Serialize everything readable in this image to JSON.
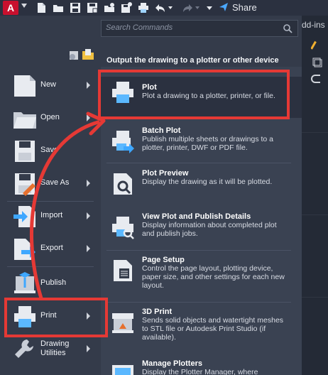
{
  "app": {
    "logo_letter": "A",
    "share_label": "Share"
  },
  "search": {
    "placeholder": "Search Commands"
  },
  "left_menu": {
    "items": [
      {
        "label": "New",
        "has_arrow": true,
        "icon": "new-icon"
      },
      {
        "label": "Open",
        "has_arrow": true,
        "icon": "open-icon"
      },
      {
        "label": "Save",
        "has_arrow": false,
        "icon": "save-icon"
      },
      {
        "label": "Save As",
        "has_arrow": true,
        "icon": "save-as-icon"
      },
      {
        "label": "Import",
        "has_arrow": true,
        "icon": "import-icon"
      },
      {
        "label": "Export",
        "has_arrow": true,
        "icon": "export-icon"
      },
      {
        "label": "Publish",
        "has_arrow": false,
        "icon": "publish-icon"
      },
      {
        "label": "Print",
        "has_arrow": true,
        "icon": "print-icon",
        "selected": true
      },
      {
        "label": "Drawing Utilities",
        "has_arrow": true,
        "icon": "drawing-utilities-icon"
      }
    ]
  },
  "right_panel": {
    "title": "Output the drawing to a plotter or other device",
    "items": [
      {
        "title": "Plot",
        "desc": "Plot a drawing to a plotter, printer, or file."
      },
      {
        "title": "Batch Plot",
        "desc": "Publish multiple sheets or drawings to a plotter, printer, DWF or PDF file."
      },
      {
        "title": "Plot Preview",
        "desc": "Display the drawing as it will be plotted."
      },
      {
        "title": "View Plot and Publish Details",
        "desc": "Display information about completed plot and publish jobs."
      },
      {
        "title": "Page Setup",
        "desc": "Control the page layout, plotting device, paper size, and other settings for each new layout."
      },
      {
        "title": "3D Print",
        "desc": "Sends solid objects and watertight meshes to STL file or Autodesk Print Studio (if available)."
      },
      {
        "title": "Manage Plotters",
        "desc": "Display the Plotter Manager, where"
      }
    ]
  },
  "background": {
    "ribbon_fragment": "dd-ins"
  },
  "annotations": {
    "highlight_color": "#e53935"
  }
}
